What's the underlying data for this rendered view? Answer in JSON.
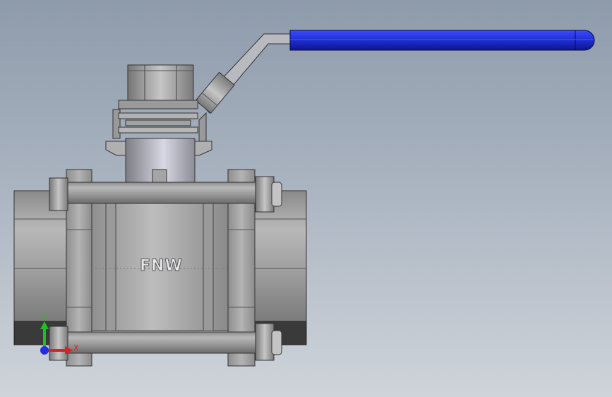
{
  "viewport": {
    "background_top": "#8e9bab",
    "background_bottom": "#cfd4da"
  },
  "model": {
    "brand_text": "FNW",
    "handle_color": "#1e2ecf",
    "body_color": "#a5a5a5"
  },
  "triad": {
    "x_label": "X",
    "y_label": "Y",
    "x_color": "#e02020",
    "y_color": "#20c020",
    "z_color": "#2030e0"
  }
}
